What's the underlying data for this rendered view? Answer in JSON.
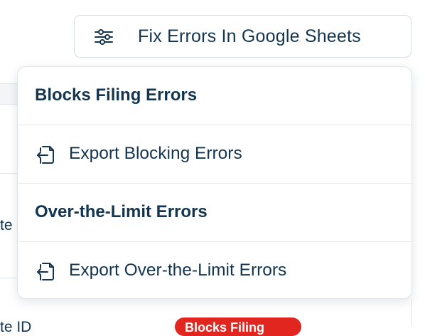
{
  "header": {
    "fix_button_label": "Fix Errors In Google Sheets",
    "fix_button_icon": "sliders-icon"
  },
  "dropdown": {
    "sections": [
      {
        "title": "Blocks Filing Errors",
        "items": [
          {
            "label": "Export Blocking Errors",
            "icon": "export-file-icon"
          }
        ]
      },
      {
        "title": "Over-the-Limit Errors",
        "items": [
          {
            "label": "Export Over-the-Limit Errors",
            "icon": "export-file-icon"
          }
        ]
      }
    ]
  },
  "background": {
    "partial_text_1": "te",
    "partial_text_2": "te ID",
    "status_badge": "Blocks Filing"
  },
  "colors": {
    "text": "#14354f",
    "border": "#d7dde2",
    "badge": "#e0261f"
  }
}
